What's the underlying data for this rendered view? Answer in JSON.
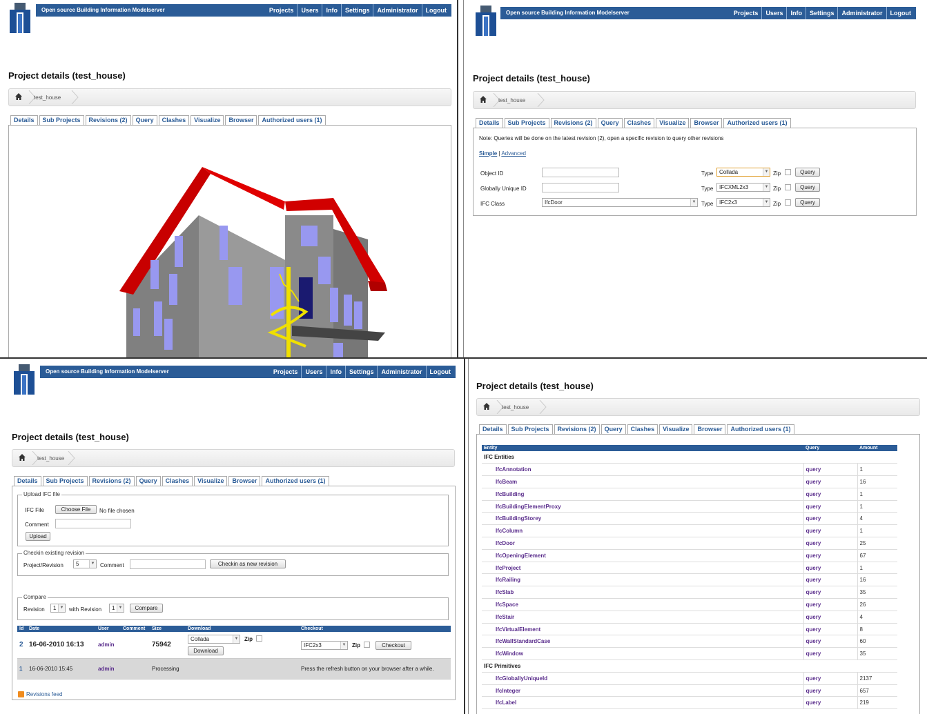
{
  "app": {
    "brand": "Open source Building Information Modelserver",
    "nav": [
      "Projects",
      "Users",
      "Info",
      "Settings",
      "Administrator",
      "Logout"
    ]
  },
  "project": {
    "title": "Project details (test_house)",
    "breadcrumb": "test_house",
    "tabs": [
      "Details",
      "Sub Projects",
      "Revisions (2)",
      "Query",
      "Clashes",
      "Visualize",
      "Browser",
      "Authorized users (1)"
    ]
  },
  "query": {
    "note": "Note: Queries will be done on the latest revision (2), open a specific revision to query other revisions",
    "mode_simple": "Simple",
    "mode_sep": "|",
    "mode_advanced": "Advanced",
    "rows": [
      {
        "label": "Object ID",
        "value": "",
        "type": "Collada"
      },
      {
        "label": "Globally Unique ID",
        "value": "",
        "type": "IFCXML2x3"
      },
      {
        "label": "IFC Class",
        "value": "IfcDoor",
        "type": "IFC2x3"
      }
    ],
    "type_label": "Type",
    "zip_label": "Zip",
    "button": "Query"
  },
  "revisions": {
    "upload_legend": "Upload IFC file",
    "ifc_file_label": "IFC File",
    "choose_file": "Choose File",
    "no_file": "No file chosen",
    "comment_label": "Comment",
    "upload_button": "Upload",
    "checkin_legend": "Checkin existing revision",
    "project_revision_label": "Project/Revision",
    "project_revision_value": "5",
    "checkin_button": "Checkin as new revision",
    "compare_legend": "Compare",
    "revision_label": "Revision",
    "revision_value": "1",
    "with_revision_label": "with Revision",
    "with_revision_value": "1",
    "compare_button": "Compare",
    "columns": [
      "Id",
      "Date",
      "User",
      "Comment",
      "Size",
      "Download",
      "Checkout"
    ],
    "rows": [
      {
        "id": "2",
        "date": "16-06-2010 16:13",
        "user": "admin",
        "comment": "",
        "size": "75942",
        "download_type": "Collada",
        "zip": "Zip",
        "download_button": "Download",
        "checkout_type": "IFC2x3",
        "checkout_zip": "Zip",
        "checkout_button": "Checkout"
      },
      {
        "id": "1",
        "date": "16-06-2010 15:45",
        "user": "admin",
        "comment": "",
        "size": "Processing",
        "note": "Press the refresh button on your browser after a while."
      }
    ],
    "feed": "Revisions feed"
  },
  "browser": {
    "columns": [
      "Entity",
      "Query",
      "Amount"
    ],
    "group1": "IFC Entities",
    "entities": [
      {
        "name": "IfcAnnotation",
        "query": "query",
        "amount": "1"
      },
      {
        "name": "IfcBeam",
        "query": "query",
        "amount": "16"
      },
      {
        "name": "IfcBuilding",
        "query": "query",
        "amount": "1"
      },
      {
        "name": "IfcBuildingElementProxy",
        "query": "query",
        "amount": "1"
      },
      {
        "name": "IfcBuildingStorey",
        "query": "query",
        "amount": "4"
      },
      {
        "name": "IfcColumn",
        "query": "query",
        "amount": "1"
      },
      {
        "name": "IfcDoor",
        "query": "query",
        "amount": "25"
      },
      {
        "name": "IfcOpeningElement",
        "query": "query",
        "amount": "67"
      },
      {
        "name": "IfcProject",
        "query": "query",
        "amount": "1"
      },
      {
        "name": "IfcRailing",
        "query": "query",
        "amount": "16"
      },
      {
        "name": "IfcSlab",
        "query": "query",
        "amount": "35"
      },
      {
        "name": "IfcSpace",
        "query": "query",
        "amount": "26"
      },
      {
        "name": "IfcStair",
        "query": "query",
        "amount": "4"
      },
      {
        "name": "IfcVirtualElement",
        "query": "query",
        "amount": "8"
      },
      {
        "name": "IfcWallStandardCase",
        "query": "query",
        "amount": "60"
      },
      {
        "name": "IfcWindow",
        "query": "query",
        "amount": "35"
      }
    ],
    "group2": "IFC Primitives",
    "primitives": [
      {
        "name": "IfcGloballyUniqueId",
        "query": "query",
        "amount": "2137"
      },
      {
        "name": "IfcInteger",
        "query": "query",
        "amount": "657"
      },
      {
        "name": "IfcLabel",
        "query": "query",
        "amount": "219"
      }
    ]
  }
}
